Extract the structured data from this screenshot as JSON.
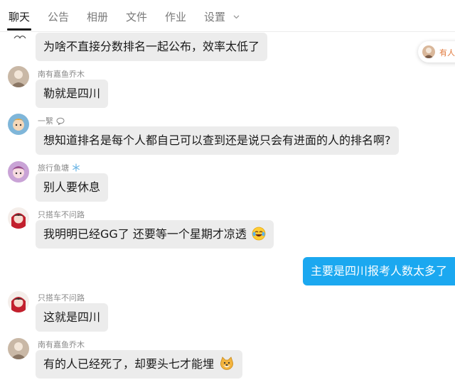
{
  "tabs": {
    "chat": "聊天",
    "notice": "公告",
    "album": "相册",
    "files": "文件",
    "homework": "作业",
    "settings": "设置"
  },
  "floating_panel": {
    "label": "有人"
  },
  "messages": [
    {
      "text": "为啥不直接分数排名一起公布，效率太低了"
    },
    {
      "sender": "南有嘉鱼乔木",
      "text": "勒就是四川"
    },
    {
      "sender": "一繄",
      "text": "想知道排名是每个人都自己可以查到还是说只会有进面的人的排名啊?"
    },
    {
      "sender": "旅行鱼塘",
      "text": "别人要休息"
    },
    {
      "sender": "只搭车不问路",
      "text": "我明明已经GG了 还要等一个星期才凉透"
    },
    {
      "text": "主要是四川报考人数太多了"
    },
    {
      "sender": "只搭车不问路",
      "text": "这就是四川"
    },
    {
      "sender": "南有嘉鱼乔木",
      "text": "有的人已经死了，却要头七才能埋"
    }
  ],
  "icons": {
    "settings_dropdown": "chevron-down-icon",
    "laughing_emoji": "face-with-tears-of-joy-icon",
    "doge_emoji": "doge-emoji-icon",
    "snowflake": "snowflake-icon",
    "speech": "speech-bubble-icon"
  },
  "colors": {
    "own_bubble": "#1ba8f0",
    "other_bubble": "#ececec",
    "active_tab": "#1a1a1a",
    "inactive_tab": "#7a7a7a"
  }
}
